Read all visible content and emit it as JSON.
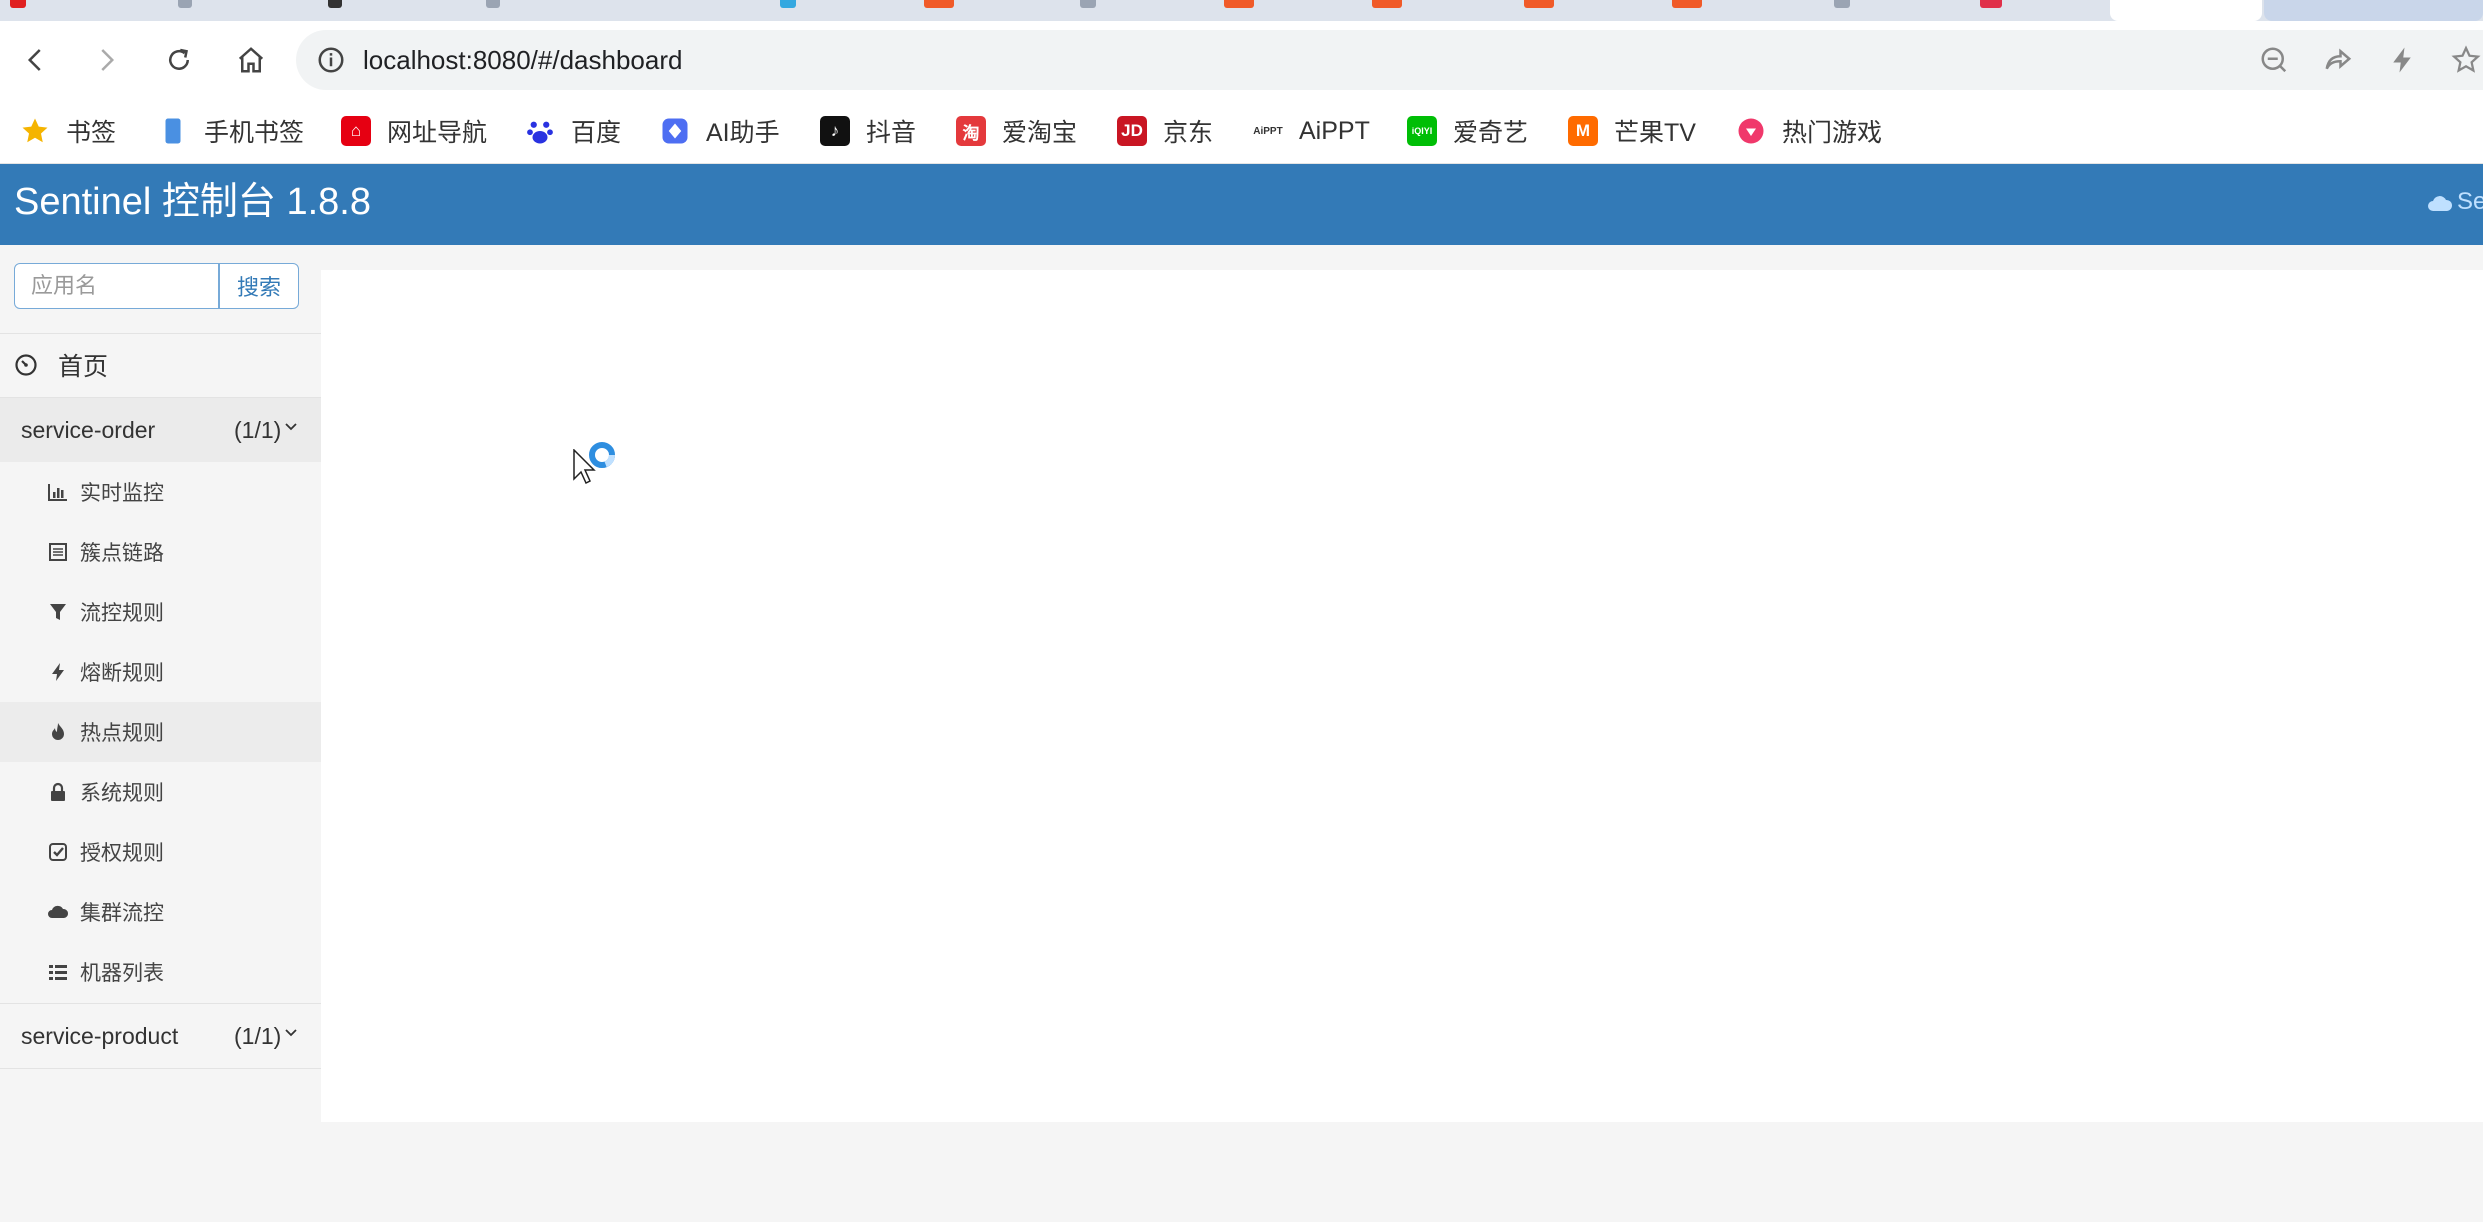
{
  "browser": {
    "url": "localhost:8080/#/dashboard",
    "bookmarks": [
      {
        "label": "书签",
        "icon": "star-icon",
        "color": "#f5b400"
      },
      {
        "label": "手机书签",
        "icon": "phone-icon",
        "color": "#4a90e2"
      },
      {
        "label": "网址导航",
        "icon": "hao123-icon",
        "color": "#e60012"
      },
      {
        "label": "百度",
        "icon": "baidu-paw-icon",
        "color": "#2932e1"
      },
      {
        "label": "AI助手",
        "icon": "ai-assistant-icon",
        "color": "#4e6ef2"
      },
      {
        "label": "抖音",
        "icon": "douyin-icon",
        "color": "#111111"
      },
      {
        "label": "爱淘宝",
        "icon": "taobao-icon",
        "color": "#e4393c"
      },
      {
        "label": "京东",
        "icon": "jd-icon",
        "color": "#c91623"
      },
      {
        "label": "AiPPT",
        "icon": "aippt-icon",
        "color": "#333333"
      },
      {
        "label": "爱奇艺",
        "icon": "iqiyi-icon",
        "color": "#00be06"
      },
      {
        "label": "芒果TV",
        "icon": "mango-icon",
        "color": "#ff6b00"
      },
      {
        "label": "热门游戏",
        "icon": "game-icon",
        "color": "#f0386b"
      }
    ]
  },
  "app": {
    "title": "Sentinel 控制台 1.8.8",
    "header_right": "Se",
    "accent": "#337ab7"
  },
  "sidebar": {
    "search": {
      "placeholder": "应用名",
      "button": "搜索"
    },
    "home": "首页",
    "apps": [
      {
        "name": "service-order",
        "count": "(1/1)",
        "expanded": true
      },
      {
        "name": "service-product",
        "count": "(1/1)",
        "expanded": false
      }
    ],
    "submenu": [
      {
        "label": "实时监控",
        "icon": "bar-chart-icon"
      },
      {
        "label": "簇点链路",
        "icon": "list-box-icon"
      },
      {
        "label": "流控规则",
        "icon": "filter-icon"
      },
      {
        "label": "熔断规则",
        "icon": "lightning-icon"
      },
      {
        "label": "热点规则",
        "icon": "fire-icon"
      },
      {
        "label": "系统规则",
        "icon": "lock-icon"
      },
      {
        "label": "授权规则",
        "icon": "check-square-icon"
      },
      {
        "label": "集群流控",
        "icon": "cloud-icon"
      },
      {
        "label": "机器列表",
        "icon": "list-icon"
      }
    ]
  }
}
